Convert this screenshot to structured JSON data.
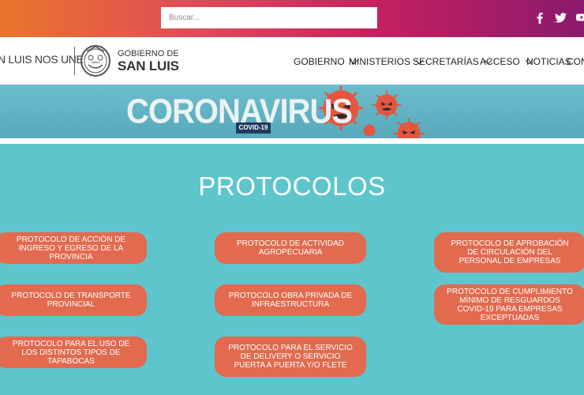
{
  "topbar": {
    "search_placeholder": "Buscar...",
    "social": [
      "facebook-icon",
      "twitter-icon",
      "youtube-icon"
    ],
    "gradient": [
      "#e9762b",
      "#e0495a",
      "#c4205f",
      "#8a1a6d"
    ]
  },
  "header": {
    "slogan": "N LUIS NOS UNE",
    "gov_line1": "GOBIERNO DE",
    "gov_line2": "SAN LUIS",
    "nav": [
      {
        "label": "GOBIERNO",
        "has_dropdown": true
      },
      {
        "label": "MINISTERIOS",
        "has_dropdown": true
      },
      {
        "label": "SECRETARÍAS",
        "has_dropdown": true
      },
      {
        "label": "ACCESO",
        "has_dropdown": true
      },
      {
        "label": "NOTICIAS",
        "has_dropdown": false
      },
      {
        "label": "CONT",
        "has_dropdown": false
      }
    ]
  },
  "banner": {
    "title": "CORONAVIRUS",
    "badge": "COVID-19"
  },
  "main": {
    "title": "PROTOCOLOS",
    "background": "#5ec5cd",
    "button_color": "#e26a4f",
    "buttons": [
      "PROTOCOLO DE ACCIÓN DE INGRESO Y EGRESO DE LA PROVINCIA",
      "PROTOCOLO DE ACTIVIDAD AGROPECUARIA",
      "PROTOCOLO DE APROBACIÓN DE CIRCULACIÓN DEL PERSONAL DE EMPRESAS",
      "PROTOCOLO DE TRANSPORTE PROVINCIAL",
      "PROTOCOLO OBRA PRIVADA DE INFRAESTRUCTURA",
      "PROTOCOLO DE CUMPLIMIENTO MÍNIMO DE RESGUARDOS COVID-19 PARA EMPRESAS EXCEPTUADAS",
      "PROTOCOLO PARA EL USO DE LOS DISTINTOS TIPOS DE TAPABOCAS",
      "PROTOCOLO PARA EL SERVICIO DE DELIVERY O SERVICIO PUERTA A PUERTA Y/O FLETE"
    ]
  }
}
